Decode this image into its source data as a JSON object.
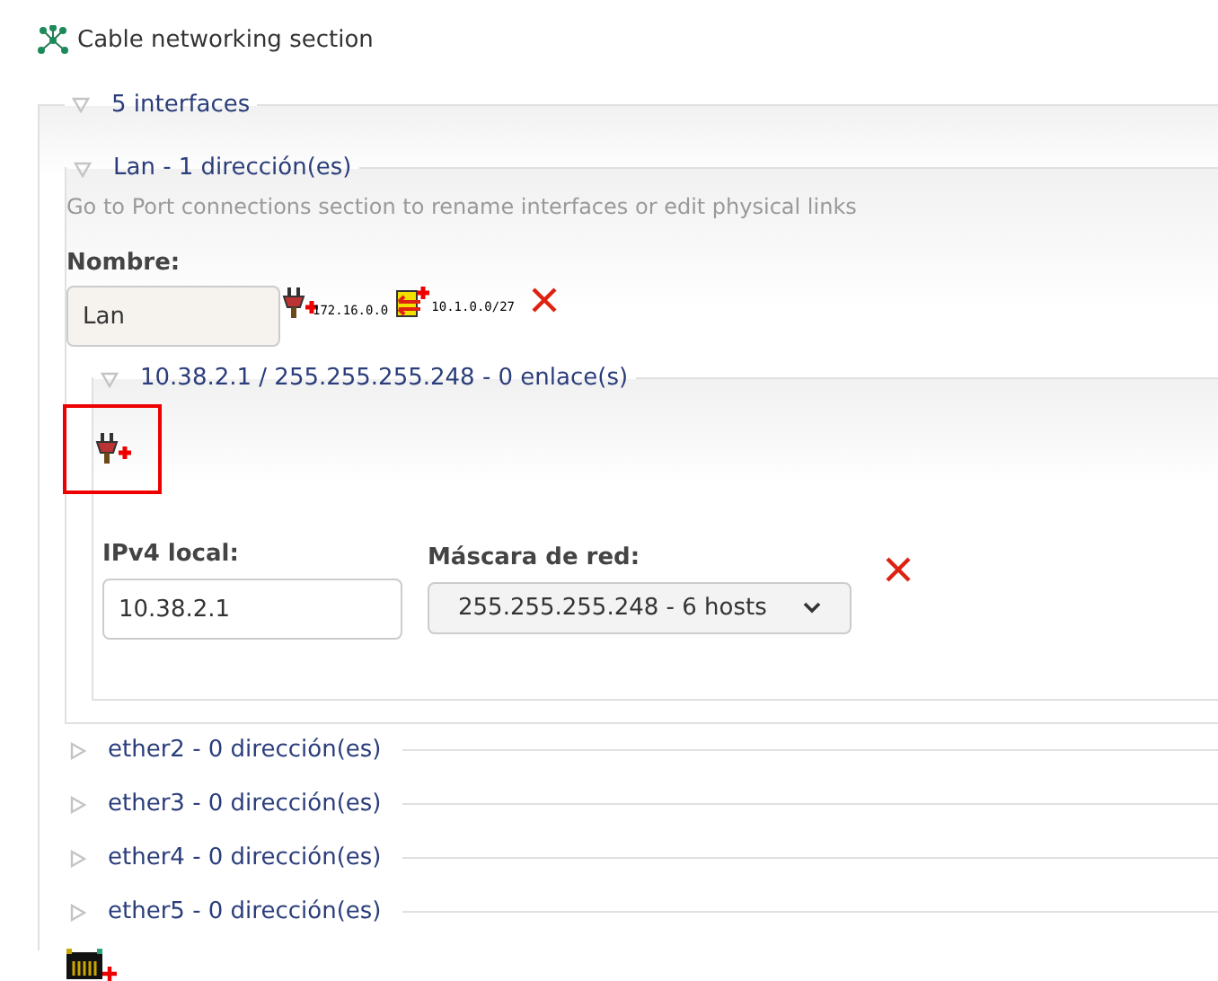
{
  "title": "Cable networking section",
  "interfaces_group": {
    "legend": "5 interfaces",
    "expanded": true,
    "interfaces": [
      {
        "legend": "Lan - 1 dirección(es)",
        "expanded": true,
        "hint": "Go to Port connections section to rename interfaces or edit physical links",
        "name_label": "Nombre:",
        "name_value": "Lan",
        "actions": [
          {
            "kind": "add-link",
            "caption": "172.16.0.0"
          },
          {
            "kind": "add-route",
            "caption": "10.1.0.0/27"
          },
          {
            "kind": "delete"
          }
        ],
        "addresses": [
          {
            "legend": "10.38.2.1 / 255.255.255.248 - 0 enlace(s)",
            "expanded": true,
            "add_link_highlighted": true,
            "ip_label": "IPv4 local:",
            "ip_value": "10.38.2.1",
            "mask_label": "Máscara de red:",
            "mask_value": "255.255.255.248 - 6 hosts"
          }
        ]
      },
      {
        "legend": "ether2 - 0 dirección(es)",
        "expanded": false
      },
      {
        "legend": "ether3 - 0 dirección(es)",
        "expanded": false
      },
      {
        "legend": "ether4 - 0 dirección(es)",
        "expanded": false
      },
      {
        "legend": "ether5 - 0 dirección(es)",
        "expanded": false
      }
    ]
  }
}
